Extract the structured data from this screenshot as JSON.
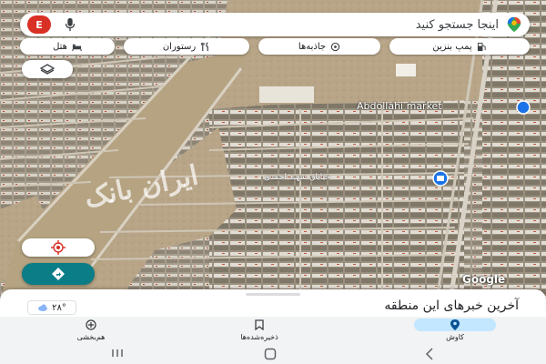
{
  "search": {
    "placeholder": "اینجا جستجو کنید",
    "avatar_letter": "E"
  },
  "chips": [
    {
      "label": "پمپ بنزین",
      "icon": "gas-station-icon"
    },
    {
      "label": "جاذبه‌ها",
      "icon": "attractions-icon"
    },
    {
      "label": "رستوران",
      "icon": "restaurant-icon"
    },
    {
      "label": "هتل",
      "icon": "hotel-icon"
    }
  ],
  "map": {
    "road_label_1": "Abdollahi market",
    "road_label_2": "خیابان شهید احمدی",
    "watermark": "ایران بانک",
    "google_logo": "Google"
  },
  "sheet": {
    "title": "آخرین خبرهای این منطقه",
    "temperature": "۲۸°"
  },
  "nav": {
    "items": [
      {
        "label": "کاوش",
        "icon": "explore-pin-icon",
        "active": true
      },
      {
        "label": "ذخیره‌شده‌ها",
        "icon": "saved-bookmark-icon",
        "active": false
      },
      {
        "label": "هم‌بخشی",
        "icon": "contribute-plus-icon",
        "active": false
      }
    ]
  },
  "colors": {
    "accent_teal": "#0b7d87",
    "avatar_red": "#d93025",
    "nav_active": "#c2e7ff"
  }
}
